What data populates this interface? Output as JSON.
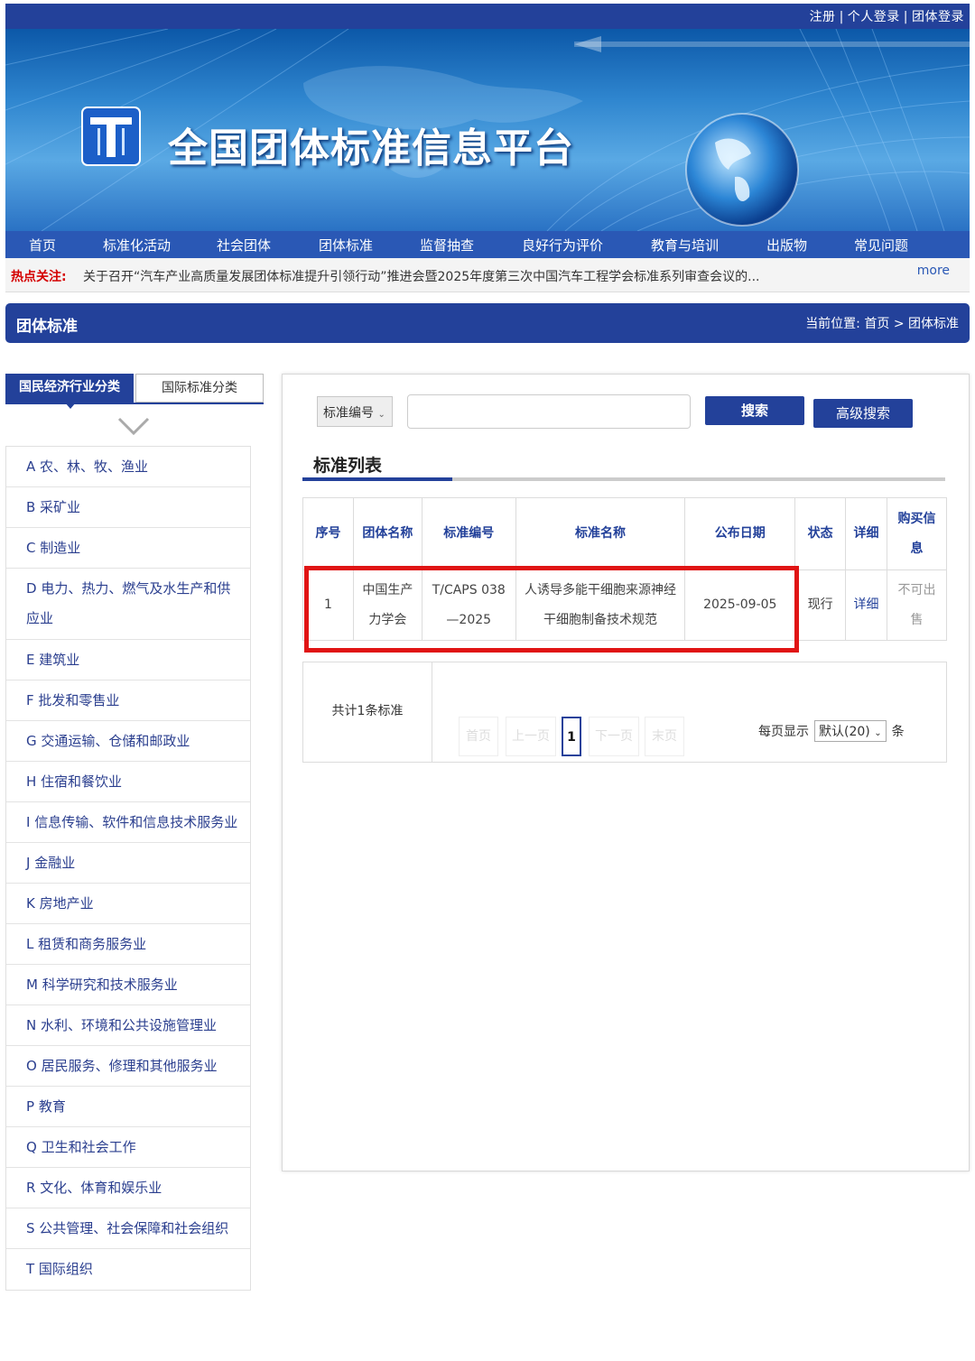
{
  "top_links": [
    "注册",
    "个人登录",
    "团体登录"
  ],
  "top_sep": "|",
  "site_title": "全国团体标准信息平台",
  "nav": [
    "首页",
    "标准化活动",
    "社会团体",
    "团体标准",
    "监督抽查",
    "良好行为评价",
    "教育与培训",
    "出版物",
    "常见问题"
  ],
  "hot": {
    "label": "热点关注:",
    "text": "关于召开“汽车产业高质量发展团体标准提升引领行动”推进会暨2025年度第三次中国汽车工程学会标准系列审查会议的...",
    "more": "more"
  },
  "section": {
    "title": "团体标准",
    "crumb_prefix": "当前位置:",
    "crumb_home": "首页",
    "crumb_sep": ">",
    "crumb_current": "团体标准"
  },
  "sidebar": {
    "tab_active": "国民经济行业分类",
    "tab_inactive": "国际标准分类",
    "items": [
      "A 农、林、牧、渔业",
      "B 采矿业",
      "C 制造业",
      "D 电力、热力、燃气及水生产和供应业",
      "E 建筑业",
      "F 批发和零售业",
      "G 交通运输、仓储和邮政业",
      "H 住宿和餐饮业",
      "I 信息传输、软件和信息技术服务业",
      "J 金融业",
      "K 房地产业",
      "L 租赁和商务服务业",
      "M 科学研究和技术服务业",
      "N 水利、环境和公共设施管理业",
      "O 居民服务、修理和其他服务业",
      "P 教育",
      "Q 卫生和社会工作",
      "R 文化、体育和娱乐业",
      "S 公共管理、社会保障和社会组织",
      "T 国际组织"
    ]
  },
  "search": {
    "select_value": "标准编号",
    "input_value": "",
    "search_label": "搜索",
    "advanced_label": "高级搜索"
  },
  "list_title": "标准列表",
  "table": {
    "headers": [
      "序号",
      "团体名称",
      "标准编号",
      "标准名称",
      "公布日期",
      "状态",
      "详细",
      "购买信息"
    ],
    "rows": [
      {
        "index": "1",
        "org": "中国生产力学会",
        "code": "T/CAPS 038—2025",
        "name": "人诱导多能干细胞来源神经干细胞制备技术规范",
        "date": "2025-09-05",
        "status": "现行",
        "detail": "详细",
        "buy": "不可出售"
      }
    ]
  },
  "pager": {
    "total_text": "共计1条标准",
    "first": "首页",
    "prev": "上一页",
    "current": "1",
    "next": "下一页",
    "last": "末页",
    "per_page_label": "每页显示",
    "per_page_value": "默认(20)",
    "per_page_unit": "条"
  },
  "colors": {
    "primary": "#23419a",
    "nav": "#2a58b5",
    "hot": "#d40000",
    "highlight": "#e01414"
  }
}
